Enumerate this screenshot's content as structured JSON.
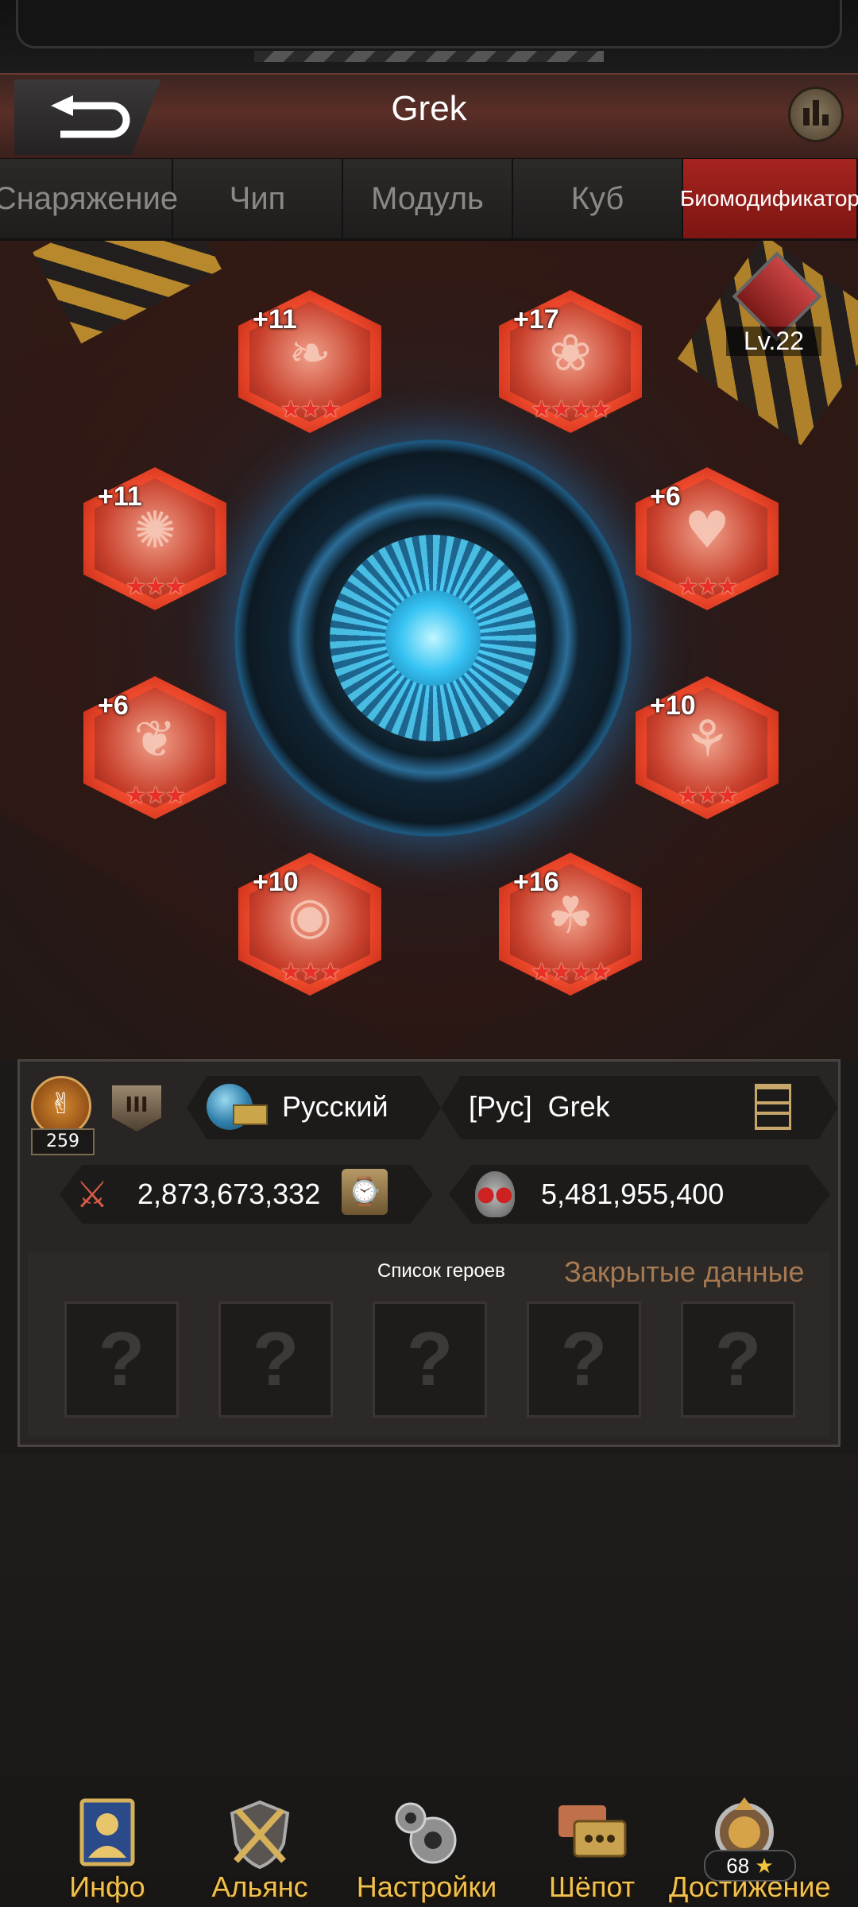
{
  "header": {
    "title": "Grek"
  },
  "tabs": [
    {
      "label": "Снаряжение",
      "active": false
    },
    {
      "label": "Чип",
      "active": false
    },
    {
      "label": "Модуль",
      "active": false
    },
    {
      "label": "Куб",
      "active": false
    },
    {
      "label": "Биомодификатор",
      "active": true
    }
  ],
  "biomod": {
    "level": "Lv.22",
    "slots": [
      {
        "plus": "+11",
        "stars": 3,
        "organ": "intestine-icon"
      },
      {
        "plus": "+17",
        "stars": 4,
        "organ": "brain-icon"
      },
      {
        "plus": "+11",
        "stars": 3,
        "organ": "nerve-icon"
      },
      {
        "plus": "+6",
        "stars": 3,
        "organ": "heart-icon"
      },
      {
        "plus": "+6",
        "stars": 3,
        "organ": "stomach-icon"
      },
      {
        "plus": "+10",
        "stars": 3,
        "organ": "lungs-icon"
      },
      {
        "plus": "+10",
        "stars": 3,
        "organ": "eye-icon"
      },
      {
        "plus": "+16",
        "stars": 4,
        "organ": "vessels-icon"
      }
    ]
  },
  "profile": {
    "medal_count": "259",
    "rank_numeral": "III",
    "language": "Русский",
    "alliance_tag": "[Рус]",
    "player_name": "Grek",
    "power": "2,873,673,332",
    "kills": "5,481,955,400"
  },
  "heroes": {
    "list_label": "Список героев",
    "hidden_label": "Закрытые данные",
    "slots": [
      "?",
      "?",
      "?",
      "?",
      "?"
    ]
  },
  "nav": [
    {
      "label": "Инфо",
      "icon": "profile-icon"
    },
    {
      "label": "Альянс",
      "icon": "alliance-icon"
    },
    {
      "label": "Настройки",
      "icon": "gear-icon"
    },
    {
      "label": "Шёпот",
      "icon": "chat-icon"
    },
    {
      "label": "Достижение",
      "icon": "trophy-icon"
    }
  ],
  "achievement_stars": "68",
  "colors": {
    "accent_red": "#a5241f",
    "gold": "#f0c14f",
    "reactor_blue": "#35c3f3"
  }
}
